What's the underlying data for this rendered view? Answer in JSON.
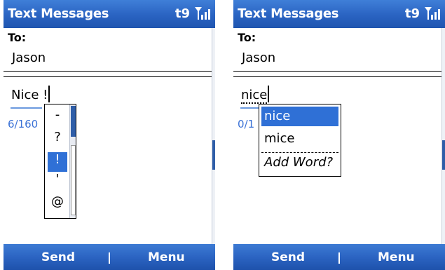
{
  "left_screen": {
    "title": "Text Messages",
    "t9_indicator": "t9",
    "to_label": "To:",
    "to_value": "Jason",
    "message_text": "Nice !",
    "char_counter": "6/160",
    "symbol_popup": {
      "items": [
        "-",
        "?",
        "!",
        "'",
        "@"
      ],
      "selected": "!"
    },
    "softkeys": {
      "left": "Send",
      "right": "Menu"
    }
  },
  "right_screen": {
    "title": "Text Messages",
    "t9_indicator": "t9",
    "to_label": "To:",
    "to_value": "Jason",
    "message_text": "nice",
    "char_counter": "0/1",
    "word_popup": {
      "items": [
        "nice",
        "mice",
        "Add Word?"
      ],
      "selected": "nice"
    },
    "softkeys": {
      "left": "Send",
      "right": "Menu"
    }
  },
  "colors": {
    "titlebar": "#2a63c2",
    "selection": "#2f70d6",
    "counter": "#3b72d6"
  },
  "icons": {
    "signal": "signal-strength-icon"
  }
}
